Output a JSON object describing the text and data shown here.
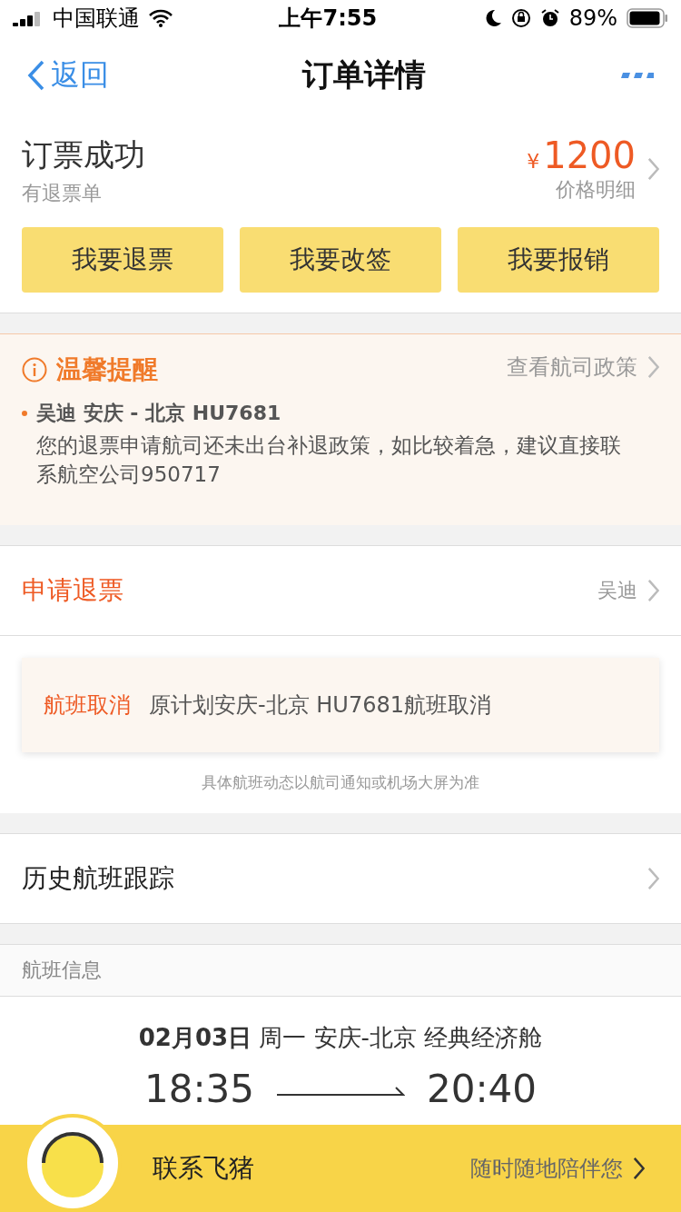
{
  "status_bar": {
    "carrier": "中国联通",
    "time": "上午7:55",
    "battery": "89%"
  },
  "nav": {
    "back": "返回",
    "title": "订单详情"
  },
  "order": {
    "status": "订票成功",
    "subtitle": "有退票单",
    "currency": "¥",
    "price": "1200",
    "price_link": "价格明细",
    "actions": [
      "我要退票",
      "我要改签",
      "我要报销"
    ]
  },
  "notice": {
    "title": "温馨提醒",
    "link": "查看航司政策",
    "items": [
      {
        "headline": "吴迪 安庆 - 北京 **HU7681**",
        "body": "您的退票申请航司还未出台补退政策，如比较着急，建议直接联系航空公司950717"
      }
    ]
  },
  "refund": {
    "label": "申请退票",
    "value": "吴迪"
  },
  "cancel": {
    "tag": "航班取消",
    "text": "原计划安庆-北京 HU7681航班取消",
    "note": "具体航班动态以航司通知或机场大屏为准"
  },
  "history": {
    "label": "历史航班跟踪"
  },
  "flight_info": {
    "header": "航班信息",
    "summary": "**02月03日** 周一 安庆-北京 经典经济舱",
    "depart": "18:35",
    "arrive": "20:40"
  },
  "bottom_bar": {
    "label": "联系飞猪",
    "slogan": "随时随地陪伴您"
  }
}
